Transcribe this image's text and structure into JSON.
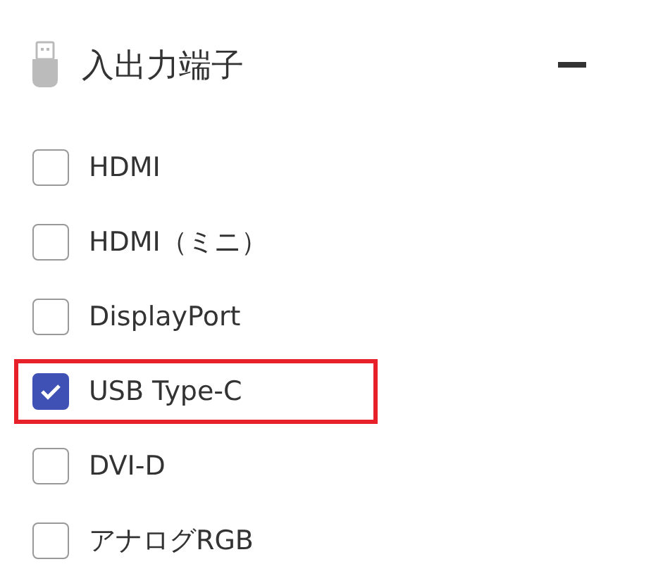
{
  "section": {
    "title": "入出力端子",
    "expanded": true
  },
  "options": [
    {
      "label": "HDMI",
      "checked": false,
      "highlighted": false
    },
    {
      "label": "HDMI（ミニ）",
      "checked": false,
      "highlighted": false
    },
    {
      "label": "DisplayPort",
      "checked": false,
      "highlighted": false
    },
    {
      "label": "USB Type-C",
      "checked": true,
      "highlighted": true
    },
    {
      "label": "DVI-D",
      "checked": false,
      "highlighted": false
    },
    {
      "label": "アナログRGB",
      "checked": false,
      "highlighted": false
    }
  ]
}
